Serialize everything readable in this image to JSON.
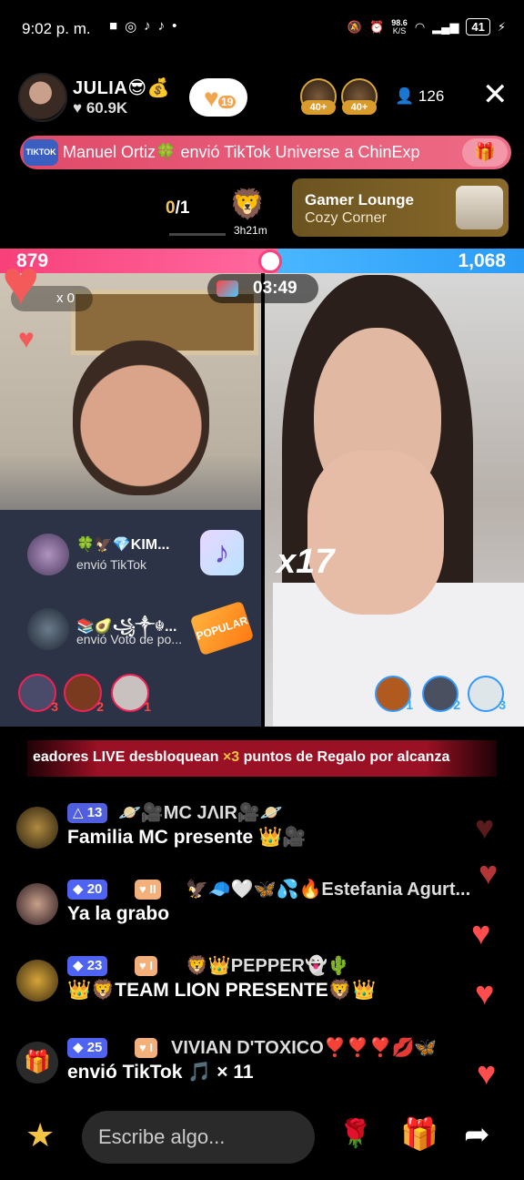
{
  "status_bar": {
    "time": "9:02 p. m.",
    "net_speed": "98.6",
    "net_unit": "K/S",
    "battery": "41"
  },
  "header": {
    "host_name": "JULIA😎💰",
    "host_likes": "♥ 60.9K",
    "follow_count": "19",
    "viewer_tags": [
      "40+",
      "40+"
    ],
    "viewer_count": "126",
    "close_icon": "close-icon"
  },
  "banner": {
    "badge": "TIKTOK LIVE",
    "text": "Manuel Ortiz🍀 envió TikTok Universe a ChinExp"
  },
  "matchbar": {
    "score_a": "0",
    "score_b": "/1",
    "lion_timer": "3h21m",
    "gamer_title": "Gamer Lounge",
    "gamer_subtitle": "Cozy Corner"
  },
  "battle": {
    "left_score": "879",
    "right_score": "1,068",
    "timer": "03:49",
    "win_label": "W",
    "win_count": "x 0",
    "multiplier": "x17"
  },
  "gifts": [
    {
      "name": "🍀🦅💎KIM...",
      "action": "envió TikTok",
      "icon": "tiktok-gift-icon"
    },
    {
      "name": "📚🥑꧁༒☬...",
      "action": "envió Voto de po...",
      "icon": "popular-badge-icon",
      "badge": "POPULAR"
    }
  ],
  "supporters_left": [
    "3",
    "2",
    "1"
  ],
  "supporters_right": [
    "1",
    "2",
    "3"
  ],
  "promo": {
    "pre": "eadores LIVE desbloquean ",
    "mult": "×3",
    "post": " puntos de Regalo por alcanza"
  },
  "comments": [
    {
      "level": "13",
      "fan": "",
      "name": "🪐🎥MC JΛIR🎥🪐",
      "message": "Familia MC presente 👑🎥",
      "level_color": "#5b6cf0"
    },
    {
      "level": "20",
      "fan": "II",
      "name": "🦅🧢🤍🦋💦🔥Estefania Agurt...",
      "message": "Ya la grabo",
      "level_color": "#4f63f2"
    },
    {
      "level": "23",
      "fan": "I",
      "name": "🦁👑PEPPER👻🌵",
      "message": "👑🦁TEAM LION PRESENTE🦁👑",
      "level_color": "#4f63f2"
    },
    {
      "level": "25",
      "fan": "I",
      "name": "VIVIAN D'TOXICO❣️❣️❣️💋🦋",
      "message": "envió TikTok 🎵  × 11",
      "level_color": "#4f63f2"
    }
  ],
  "input": {
    "placeholder": "Escribe algo..."
  },
  "bottom_icons": [
    "star-icon",
    "rose-icon",
    "gift-icon",
    "share-icon"
  ]
}
